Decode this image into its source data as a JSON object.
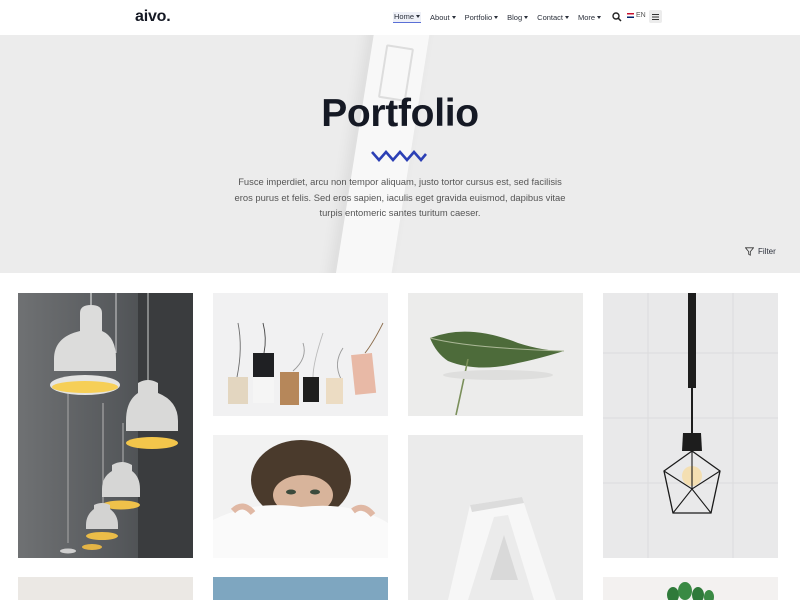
{
  "header": {
    "logo": "aivo.",
    "nav": [
      {
        "label": "Home"
      },
      {
        "label": "About"
      },
      {
        "label": "Portfolio"
      },
      {
        "label": "Blog"
      },
      {
        "label": "Contact"
      },
      {
        "label": "More"
      }
    ],
    "language": "EN",
    "icons": {
      "search": "search-icon",
      "menu": "hamburger-icon",
      "flag": "uk-flag-icon"
    }
  },
  "hero": {
    "title": "Portfolio",
    "description": "Fusce imperdiet, arcu non tempor aliquam, justo tortor cursus est, sed facilisis eros purus et felis. Sed eros sapien, iaculis eget gravida euismod, dapibus vitae turpis entomeric santes turitum caeser.",
    "filter_label": "Filter",
    "accent_color": "#2b3fb5"
  },
  "portfolio": {
    "items": [
      {
        "subject": "pendant-lamps"
      },
      {
        "subject": "gift-tags"
      },
      {
        "subject": "green-leaf"
      },
      {
        "subject": "hanging-bulb"
      },
      {
        "subject": "woman-under-blanket"
      },
      {
        "subject": "letter-a"
      },
      {
        "subject": "beige-partial"
      },
      {
        "subject": "blue-partial"
      },
      {
        "subject": "plant-partial"
      }
    ]
  }
}
